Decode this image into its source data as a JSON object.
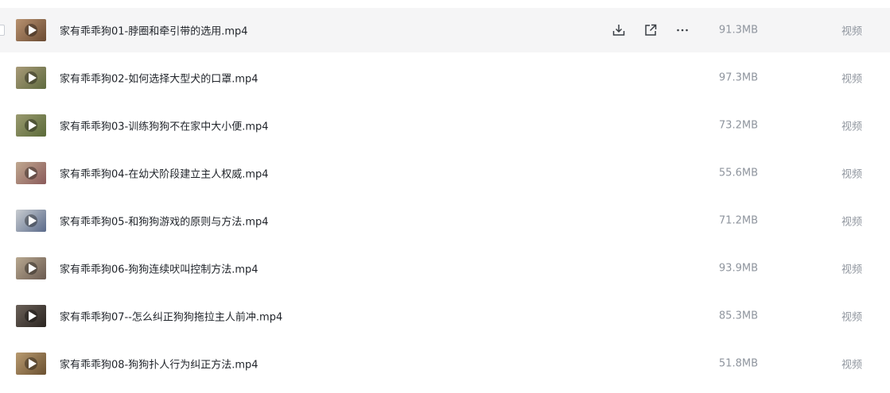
{
  "files": [
    {
      "name": "家有乖乖狗01-脖圈和牵引带的选用.mp4",
      "size": "91.3MB",
      "type": "视频",
      "thumb_color": "#8a6a4a"
    },
    {
      "name": "家有乖乖狗02-如何选择大型犬的口罩.mp4",
      "size": "97.3MB",
      "type": "视频",
      "thumb_color": "#7a7a5a"
    },
    {
      "name": "家有乖乖狗03-训练狗狗不在家中大小便.mp4",
      "size": "73.2MB",
      "type": "视频",
      "thumb_color": "#6e7a50"
    },
    {
      "name": "家有乖乖狗04-在幼犬阶段建立主人权威.mp4",
      "size": "55.6MB",
      "type": "视频",
      "thumb_color": "#9a7a6a"
    },
    {
      "name": "家有乖乖狗05-和狗狗游戏的原则与方法.mp4",
      "size": "71.2MB",
      "type": "视频",
      "thumb_color": "#7a8a9a"
    },
    {
      "name": "家有乖乖狗06-狗狗连续吠叫控制方法.mp4",
      "size": "93.9MB",
      "type": "视频",
      "thumb_color": "#8a7a6a"
    },
    {
      "name": "家有乖乖狗07--怎么纠正狗狗拖拉主人前冲.mp4",
      "size": "85.3MB",
      "type": "视频",
      "thumb_color": "#4a4038"
    },
    {
      "name": "家有乖乖狗08-狗狗扑人行为纠正方法.mp4",
      "size": "51.8MB",
      "type": "视频",
      "thumb_color": "#8a7050"
    }
  ],
  "hover_actions": [
    {
      "icon": "download-icon"
    },
    {
      "icon": "share-icon"
    },
    {
      "icon": "more-icon"
    }
  ],
  "colors": {
    "hover_bg": "#f5f5f6",
    "name_text": "#1f2329",
    "meta_text": "#8f959e"
  }
}
